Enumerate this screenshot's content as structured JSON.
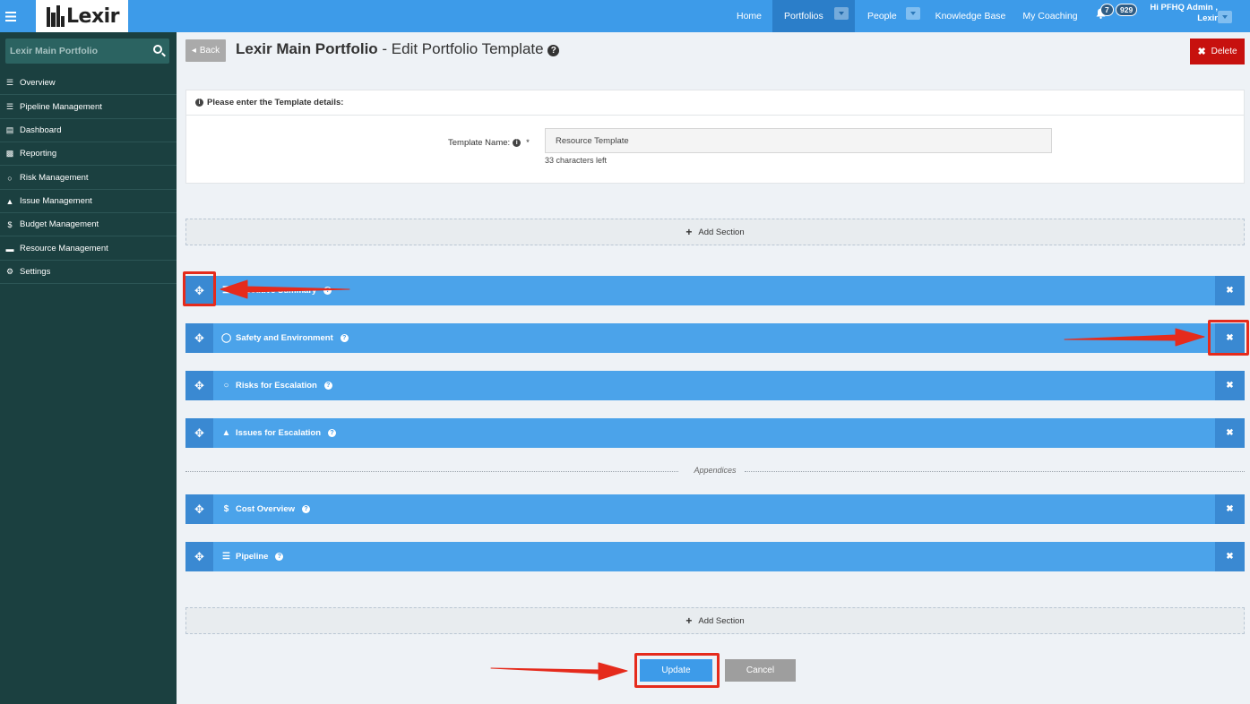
{
  "topbar": {
    "logo_text": "Lexir",
    "nav": [
      {
        "label": "Home"
      },
      {
        "label": "Portfolios"
      },
      {
        "label": "People"
      },
      {
        "label": "Knowledge Base"
      },
      {
        "label": "My Coaching"
      }
    ],
    "notifications": {
      "alerts_count": "7",
      "messages_count": "929"
    },
    "user": {
      "greeting": "Hi PFHQ Admin ,",
      "org": "Lexir"
    }
  },
  "sidebar": {
    "search_placeholder": "Lexir Main Portfolio",
    "items": [
      {
        "label": "Overview",
        "icon": "list-icon"
      },
      {
        "label": "Pipeline Management",
        "icon": "list-icon"
      },
      {
        "label": "Dashboard",
        "icon": "dashboard-icon"
      },
      {
        "label": "Reporting",
        "icon": "bar-chart-icon"
      },
      {
        "label": "Risk Management",
        "icon": "lightbulb-icon"
      },
      {
        "label": "Issue Management",
        "icon": "warning-icon"
      },
      {
        "label": "Budget Management",
        "icon": "dollar-icon"
      },
      {
        "label": "Resource Management",
        "icon": "folder-icon"
      },
      {
        "label": "Settings",
        "icon": "cogs-icon"
      }
    ]
  },
  "header": {
    "back_label": "Back",
    "title_bold": "Lexir Main Portfolio",
    "title_rest": " - Edit Portfolio Template",
    "delete_label": "Delete"
  },
  "details": {
    "heading": "Please enter the Template details:",
    "template_name_label": "Template Name:",
    "required_mark": "*",
    "template_name_value": "Resource Template",
    "chars_left": "33 characters left"
  },
  "add_section_label": "Add Section",
  "sections": [
    {
      "label": "Executive Summary",
      "icon": "text-icon"
    },
    {
      "label": "Safety and Environment",
      "icon": "globe-icon"
    },
    {
      "label": "Risks for Escalation",
      "icon": "lightbulb-icon"
    },
    {
      "label": "Issues for Escalation",
      "icon": "warning-icon"
    }
  ],
  "appendices_label": "Appendices",
  "appendix_sections": [
    {
      "label": "Cost Overview",
      "icon": "dollar-icon"
    },
    {
      "label": "Pipeline",
      "icon": "list-icon"
    }
  ],
  "actions": {
    "update_label": "Update",
    "cancel_label": "Cancel"
  },
  "colors": {
    "topbar": "#3d9be9",
    "sidebar": "#1b4040",
    "section_bar": "#4ba3ea",
    "delete": "#c7110e",
    "annotation": "#e52b1c"
  }
}
